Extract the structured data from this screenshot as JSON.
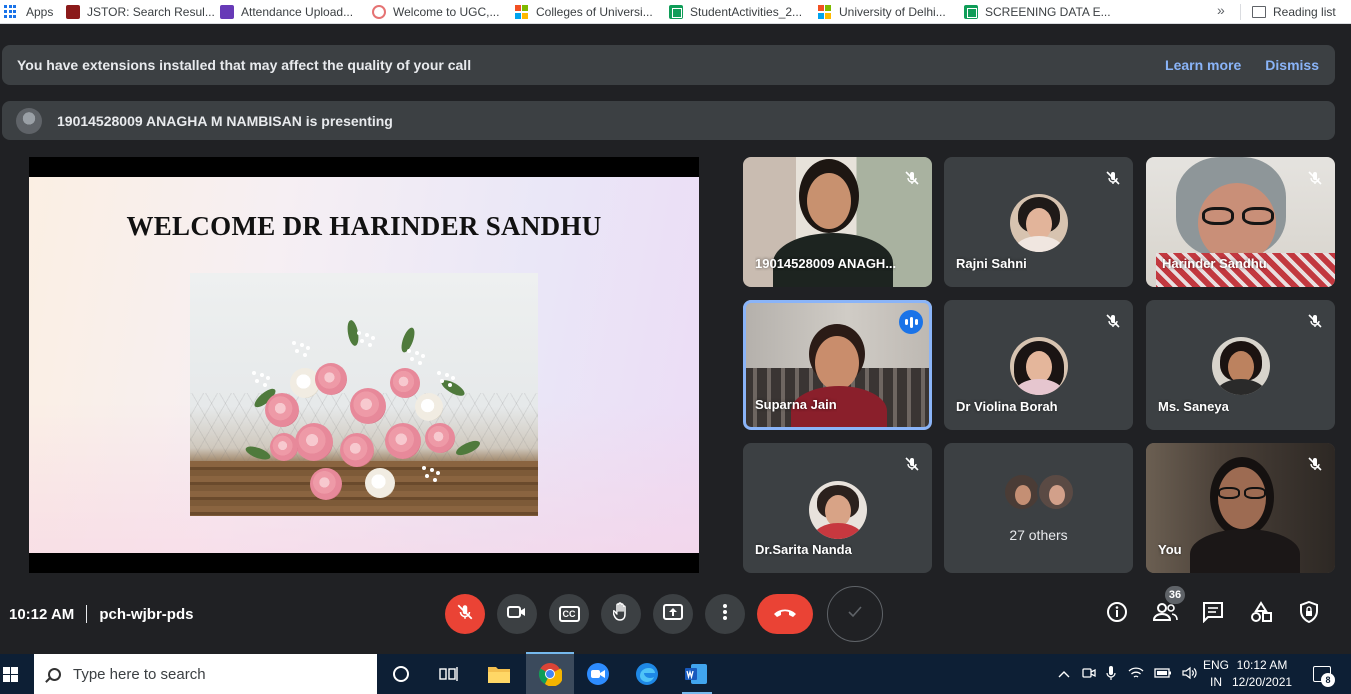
{
  "bookmarks": {
    "items": [
      {
        "label": "Apps"
      },
      {
        "label": "JSTOR: Search Resul..."
      },
      {
        "label": "Attendance Upload..."
      },
      {
        "label": "Welcome to UGC,..."
      },
      {
        "label": "Colleges of Universi..."
      },
      {
        "label": "StudentActivities_2..."
      },
      {
        "label": "University of Delhi..."
      },
      {
        "label": "SCREENING DATA E..."
      }
    ],
    "more": "»",
    "reading_list": "Reading list"
  },
  "warning_banner": {
    "text": "You have extensions installed that may affect the quality of your call",
    "learn_more": "Learn more",
    "dismiss": "Dismiss"
  },
  "presenting_banner": {
    "text": "19014528009 ANAGHA M NAMBISAN is presenting"
  },
  "slide": {
    "title": "WELCOME DR HARINDER SANDHU"
  },
  "participants": [
    {
      "name": "19014528009 ANAGH...",
      "muted": true
    },
    {
      "name": "Rajni Sahni",
      "muted": true
    },
    {
      "name": "Harinder Sandhu",
      "muted": true
    },
    {
      "name": "Suparna Jain",
      "muted": false,
      "speaking": true
    },
    {
      "name": "Dr Violina Borah",
      "muted": true
    },
    {
      "name": "Ms. Saneya",
      "muted": true
    },
    {
      "name": "Dr.Sarita Nanda",
      "muted": true
    },
    {
      "name": "27 others"
    },
    {
      "name": "You",
      "muted": true
    }
  ],
  "meeting": {
    "time": "10:12 AM",
    "code": "pch-wjbr-pds",
    "people_count": "36"
  },
  "controls": {
    "mic": "mic-off-icon",
    "camera": "camera-icon",
    "captions": "CC",
    "hand": "raise-hand-icon",
    "present": "present-icon",
    "more": "more-options-icon",
    "end": "end-call-icon"
  },
  "colors": {
    "background": "#202124",
    "surface": "#3c4043",
    "accent_blue": "#8ab4f8",
    "red": "#ea4335",
    "speaking_blue": "#1a73e8"
  },
  "taskbar": {
    "search_placeholder": "Type here to search",
    "lang_line1": "ENG",
    "lang_line2": "IN",
    "clock_time": "10:12 AM",
    "clock_date": "12/20/2021",
    "notifications": "8"
  }
}
